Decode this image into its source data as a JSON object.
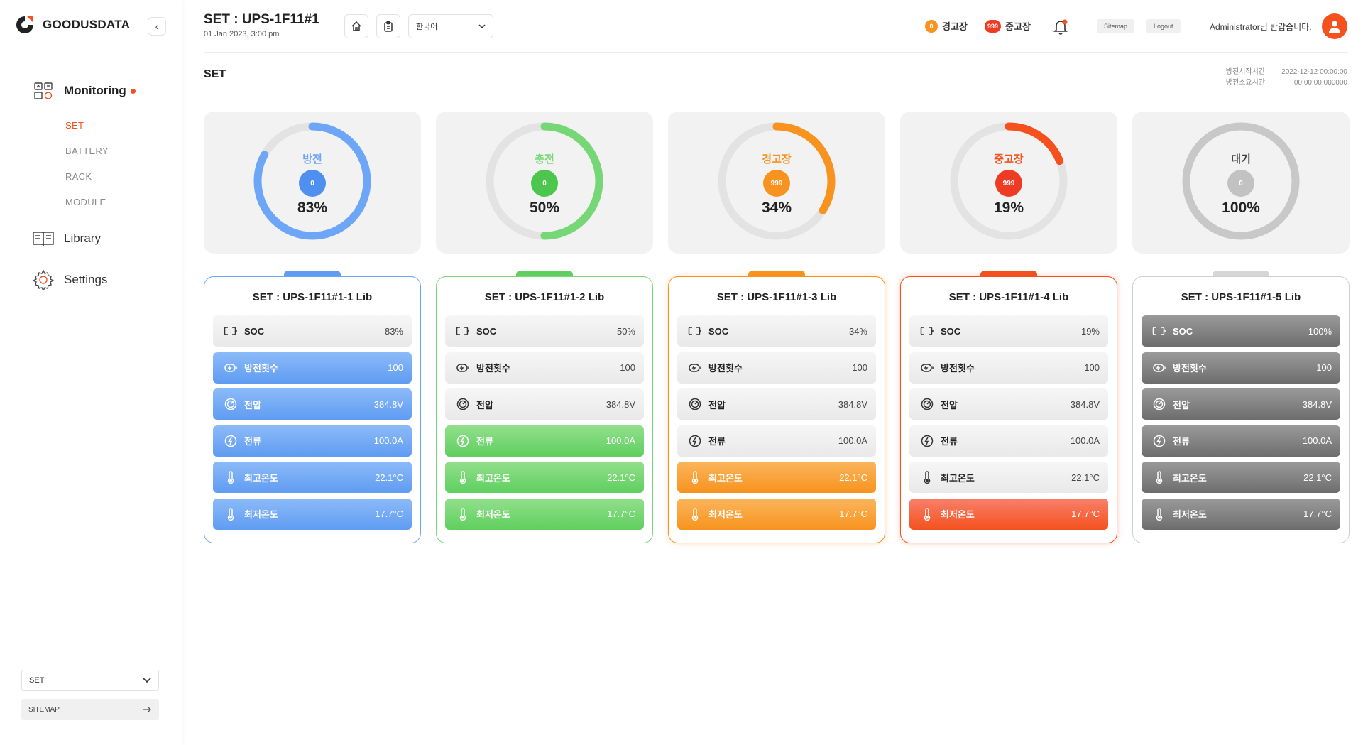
{
  "brand": {
    "name": "GOODUSDATA"
  },
  "sidebar": {
    "collapse_glyph": "‹",
    "nav": [
      {
        "label": "Monitoring",
        "icon": "monitoring-icon"
      },
      {
        "label": "Library",
        "icon": "library-icon"
      },
      {
        "label": "Settings",
        "icon": "gear-icon"
      }
    ],
    "sub_items": [
      "SET",
      "BATTERY",
      "RACK",
      "MODULE"
    ],
    "select_value": "SET",
    "sitemap_label": "SITEMAP"
  },
  "header": {
    "title": "SET : UPS-1F11#1",
    "date": "01 Jan 2023, 3:00 pm",
    "language": "한국어",
    "warning": {
      "count": "0",
      "label": "경고장",
      "color": "#f7931e"
    },
    "fault": {
      "count": "999",
      "label": "중고장",
      "color": "#ee3b23"
    },
    "sitemap_btn": "Sitemap",
    "logout_btn": "Logout",
    "admin_greeting": "Administrator님 반갑습니다."
  },
  "page": {
    "label": "SET",
    "discharge_start_label": "방전시작시간",
    "discharge_start_value": "2022-12-12 00:00:00",
    "discharge_duration_label": "방전소요시간",
    "discharge_duration_value": "00:00:00.000000"
  },
  "gauges": [
    {
      "label": "방전",
      "count": "0",
      "percent": "83%",
      "value": 0.83,
      "color": "#6ea6f7",
      "badge": "#4e8ff0"
    },
    {
      "label": "충전",
      "count": "0",
      "percent": "50%",
      "value": 0.5,
      "color": "#76d776",
      "badge": "#4cc64c"
    },
    {
      "label": "경고장",
      "count": "999",
      "percent": "34%",
      "value": 0.34,
      "color": "#f7931e",
      "badge": "#f7931e"
    },
    {
      "label": "중고장",
      "count": "999",
      "percent": "19%",
      "value": 0.19,
      "color": "#f4511e",
      "badge": "#ee3b23"
    },
    {
      "label": "대기",
      "count": "0",
      "percent": "100%",
      "value": 1.0,
      "color": "#c8c8c8",
      "badge": "#c2c2c2"
    }
  ],
  "metric_labels": [
    "SOC",
    "방전횟수",
    "전압",
    "전류",
    "최고온도",
    "최저온도"
  ],
  "libs": [
    {
      "title": "SET : UPS-1F11#1-1 Lib",
      "color": "#5f9cf2",
      "light": "#8cbaf8",
      "border": "#6ea6f7",
      "values": [
        "83%",
        "100",
        "384.8V",
        "100.0A",
        "22.1°C",
        "17.7°C"
      ],
      "active": [
        false,
        true,
        true,
        true,
        true,
        true
      ]
    },
    {
      "title": "SET : UPS-1F11#1-2 Lib",
      "color": "#5fcf5f",
      "light": "#92df8c",
      "border": "#76d776",
      "values": [
        "50%",
        "100",
        "384.8V",
        "100.0A",
        "22.1°C",
        "17.7°C"
      ],
      "active": [
        false,
        false,
        false,
        true,
        true,
        true
      ]
    },
    {
      "title": "SET : UPS-1F11#1-3 Lib",
      "color": "#f7931e",
      "light": "#fbb55c",
      "border": "#f7931e",
      "values": [
        "34%",
        "100",
        "384.8V",
        "100.0A",
        "22.1°C",
        "17.7°C"
      ],
      "active": [
        false,
        false,
        false,
        false,
        true,
        true
      ]
    },
    {
      "title": "SET : UPS-1F11#1-4 Lib",
      "color": "#f4511e",
      "light": "#f8806a",
      "border": "#f4511e",
      "values": [
        "19%",
        "100",
        "384.8V",
        "100.0A",
        "22.1°C",
        "17.7°C"
      ],
      "active": [
        false,
        false,
        false,
        false,
        false,
        true
      ]
    },
    {
      "title": "SET : UPS-1F11#1-5 Lib",
      "color": "#6d6d6d",
      "light": "#9a9a9a",
      "border": "#cfcfcf",
      "values": [
        "100%",
        "100",
        "384.8V",
        "100.0A",
        "22.1°C",
        "17.7°C"
      ],
      "active": [
        true,
        true,
        true,
        true,
        true,
        true
      ]
    }
  ]
}
